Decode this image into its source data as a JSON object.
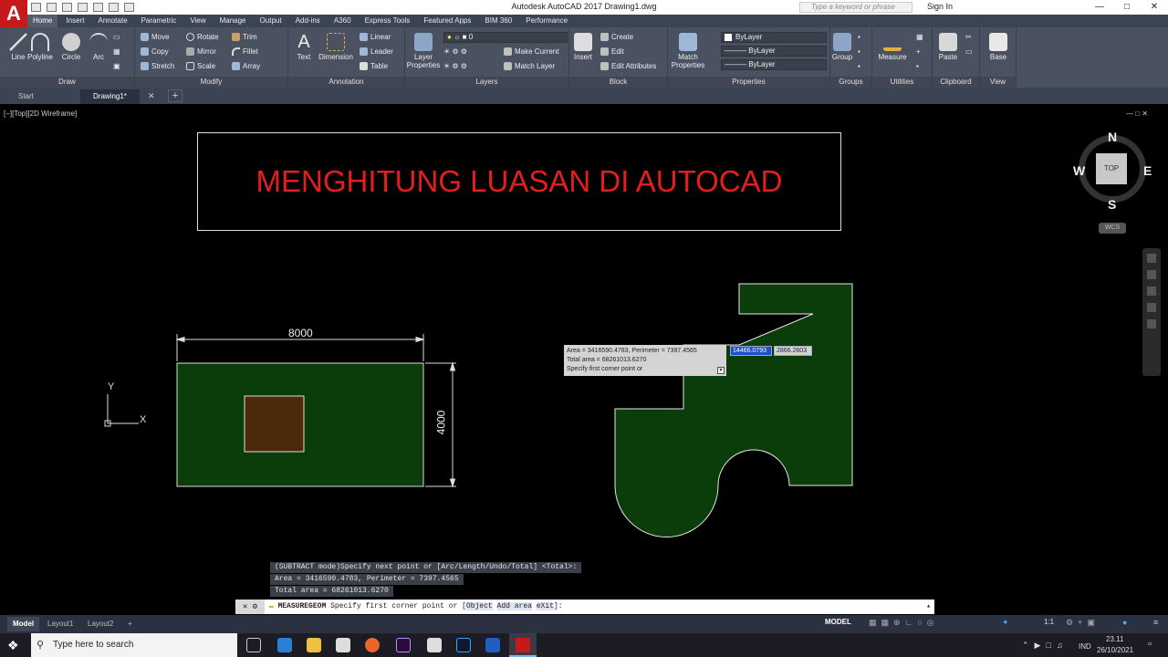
{
  "window": {
    "title": "Autodesk AutoCAD 2017    Drawing1.dwg",
    "search_placeholder": "Type a keyword or phrase",
    "sign_in": "Sign In",
    "logo": "A"
  },
  "ribbon_tabs": [
    "Home",
    "Insert",
    "Annotate",
    "Parametric",
    "View",
    "Manage",
    "Output",
    "Add-ins",
    "A360",
    "Express Tools",
    "Featured Apps",
    "BIM 360",
    "Performance"
  ],
  "ribbon": {
    "draw": {
      "title": "Draw",
      "line": "Line",
      "polyline": "Polyline",
      "circle": "Circle",
      "arc": "Arc"
    },
    "modify": {
      "title": "Modify",
      "move": "Move",
      "rotate": "Rotate",
      "trim": "Trim",
      "copy": "Copy",
      "mirror": "Mirror",
      "fillet": "Fillet",
      "stretch": "Stretch",
      "scale": "Scale",
      "array": "Array"
    },
    "annotation": {
      "title": "Annotation",
      "text": "Text",
      "dimension": "Dimension",
      "linear": "Linear",
      "leader": "Leader",
      "table": "Table"
    },
    "layers": {
      "title": "Layers",
      "layer_properties_1": "Layer",
      "layer_properties_2": "Properties",
      "layer_current": "0",
      "make_current": "Make Current",
      "match_layer": "Match Layer"
    },
    "block": {
      "title": "Block",
      "insert": "Insert",
      "create": "Create",
      "edit": "Edit",
      "edit_attributes": "Edit Attributes"
    },
    "properties": {
      "title": "Properties",
      "match_1": "Match",
      "match_2": "Properties",
      "color": "ByLayer",
      "linetype": "ByLayer",
      "lineweight": "ByLayer"
    },
    "groups": {
      "title": "Groups",
      "group": "Group"
    },
    "utilities": {
      "title": "Utilities",
      "measure": "Measure"
    },
    "clipboard": {
      "title": "Clipboard",
      "paste": "Paste"
    },
    "view": {
      "title": "View",
      "base": "Base"
    }
  },
  "doc_tabs": {
    "start": "Start",
    "drawing": "Drawing1*"
  },
  "viewport_label": "[−][Top][2D Wireframe]",
  "drawing": {
    "title_text": "MENGHITUNG LUASAN DI AUTOCAD",
    "dim_horizontal": "8000",
    "dim_vertical": "4000",
    "ucs_x": "X",
    "ucs_y": "Y"
  },
  "viewcube": {
    "n": "N",
    "s": "S",
    "e": "E",
    "w": "W",
    "face": "TOP",
    "wcs": "WCS"
  },
  "tooltip": {
    "line1": "Area = 3416590.4783, Perimeter = 7397.4565",
    "line2": "Total area = 68261013.6270",
    "line3": "Specify first corner point or",
    "input1": "14466.0793",
    "input2": "2866.2603"
  },
  "command_history": [
    "(SUBTRACT mode)Specify next point or [Arc/Length/Undo/Total] <Total>:",
    "Area = 3416590.4783, Perimeter = 7397.4565",
    "Total area = 68261013.6270"
  ],
  "command_line": {
    "command": "MEASUREGEOM",
    "prompt": "Specify first corner point or [",
    "opt1": "Object",
    "opt2": "Add area",
    "opt3": "eXit",
    "end": "]:"
  },
  "layout_tabs": {
    "model": "Model",
    "layout1": "Layout1",
    "layout2": "Layout2"
  },
  "status": {
    "model": "MODEL",
    "scale": "1:1"
  },
  "taskbar": {
    "search": "Type here to search",
    "time": "23.11",
    "date": "26/10/2021",
    "lang": "IND"
  },
  "colors": {
    "accent": "#c61a1a",
    "title_text": "#e41e1e",
    "hatch": "#0b3d0b",
    "inner_square": "#4a2a08",
    "ribbon": "#4a5160"
  }
}
